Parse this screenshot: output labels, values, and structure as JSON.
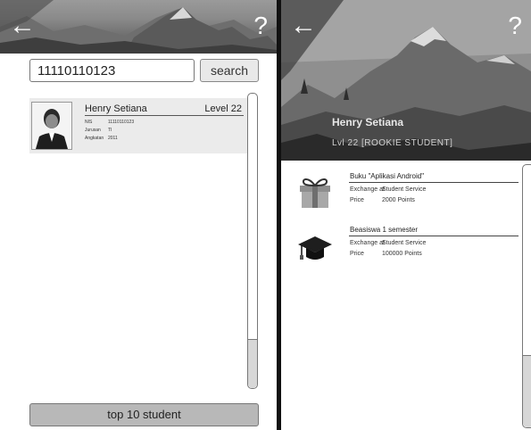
{
  "left_screen": {
    "header": {
      "back_icon": "arrow-left-icon",
      "help_icon": "question-mark-icon"
    },
    "search": {
      "value": "11110110123",
      "button_label": "search"
    },
    "result": {
      "name": "Henry Setiana",
      "level": "Level 22",
      "fields": [
        {
          "key": "NIS",
          "value": "11110110123"
        },
        {
          "key": "Jurusan",
          "value": "TI"
        },
        {
          "key": "Angkatan",
          "value": "2011"
        }
      ]
    },
    "top10_button_label": "top 10 student"
  },
  "right_screen": {
    "header": {
      "back_icon": "arrow-left-icon",
      "help_icon": "question-mark-icon"
    },
    "profile": {
      "name": "Henry Setiana",
      "level": "Lvl 22 [ROOKIE STUDENT]"
    },
    "rewards": [
      {
        "icon": "gift-icon",
        "title": "Buku \"Aplikasi Android\"",
        "exchange_label": "Exchange at",
        "exchange_value": "Student Service",
        "price_label": "Price",
        "price_value": "2000 Points"
      },
      {
        "icon": "graduation-cap-icon",
        "title": "Beasiswa 1 semester",
        "exchange_label": "Exchange at",
        "exchange_value": "Student Service",
        "price_label": "Price",
        "price_value": "100000 Points"
      }
    ]
  }
}
